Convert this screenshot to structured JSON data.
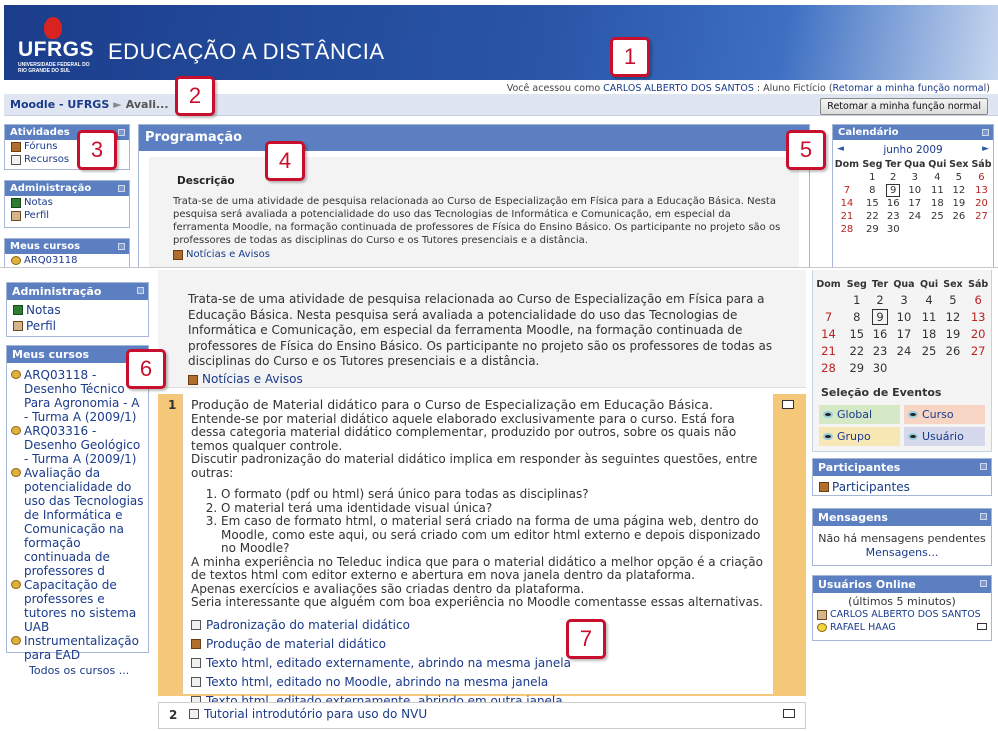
{
  "header": {
    "logo_text": "UFRGS",
    "logo_subtitle": "UNIVERSIDADE FEDERAL DO RIO GRANDE DO SUL",
    "site_title": "EDUCAÇÃO A DISTÂNCIA",
    "login_prefix": "Você acessou como",
    "login_user": "CARLOS ALBERTO DOS SANTOS",
    "login_role": ": Aluno Fictício (",
    "login_return_link": "Retomar a minha função normal",
    "login_suffix": ")"
  },
  "navbar": {
    "crumb_home": "Moodle - UFRGS",
    "crumb_sep": "►",
    "crumb_current": "Avali...",
    "return_button": "Retomar a minha função normal"
  },
  "blocks_top": {
    "atividades": {
      "title": "Atividades",
      "items": [
        "Fóruns",
        "Recursos"
      ]
    },
    "administracao": {
      "title": "Administração",
      "items": [
        "Notas",
        "Perfil"
      ]
    },
    "meus_cursos": {
      "title": "Meus cursos",
      "peek": "ARQ03118"
    }
  },
  "programacao": {
    "title": "Programação",
    "desc_heading": "Descrição",
    "desc_text": "Trata-se de uma atividade de pesquisa relacionada ao Curso de Especialização em Física para a Educação Básica. Nesta pesquisa será avaliada a potencialidade do uso das Tecnologias de Informática e Comunicação, em especial da ferramenta Moodle, na formação continuada de professores de Física do Ensino Básico. Os participante no projeto são os professores de todas as disciplinas do Curso e os Tutores presenciais e a distância.",
    "news_link": "Notícias e Avisos"
  },
  "calendar": {
    "title": "Calendário",
    "month": "junho 2009",
    "prev": "◄",
    "next": "►",
    "weekdays": [
      "Dom",
      "Seg",
      "Ter",
      "Qua",
      "Qui",
      "Sex",
      "Sáb"
    ],
    "weeks": [
      [
        "",
        "1",
        "2",
        "3",
        "4",
        "5",
        "6"
      ],
      [
        "7",
        "8",
        "9",
        "10",
        "11",
        "12",
        "13"
      ],
      [
        "14",
        "15",
        "16",
        "17",
        "18",
        "19",
        "20"
      ],
      [
        "21",
        "22",
        "23",
        "24",
        "25",
        "26",
        "27"
      ],
      [
        "28",
        "29",
        "30",
        "",
        "",
        "",
        ""
      ]
    ],
    "today": "9",
    "events_title": "Seleção de Eventos",
    "events": [
      "Global",
      "Curso",
      "Grupo",
      "Usuário"
    ]
  },
  "meus_cursos": {
    "title": "Meus cursos",
    "courses": [
      "ARQ03118 - Desenho Técnico Para Agronomia - A - Turma A (2009/1)",
      "ARQ03316 - Desenho Geológico - Turma A (2009/1)",
      "Avaliação da potencialidade do uso das Tecnologias de Informática e Comunicação na formação continuada de professores d",
      "Capacitação de professores e tutores no sistema UAB",
      "Instrumentalização para EAD"
    ],
    "all_courses": "Todos os cursos ..."
  },
  "topic1": {
    "number": "1",
    "title": "Produção de Material didático para o Curso de Especialização em Educação Básica.",
    "para1": "Entende-se por material didático aquele elaborado exclusivamente para o curso. Está fora dessa categoria material didático complementar, produzido por outros, sobre os quais não temos qualquer controle.",
    "para2": "Discutir padronização do material didático implica em responder às seguintes questões, entre outras:",
    "questions": [
      "O formato (pdf ou html) será único para todas as disciplinas?",
      "O material terá uma identidade visual única?",
      "Em caso de formato html, o material será criado na forma de uma página web, dentro do Moodle, como este aqui, ou será criado com um editor html externo e depois disponizado no Moodle?"
    ],
    "para3": "A minha experiência no Teleduc indica que para o material didático a melhor opção é a criação de textos html com editor externo e abertura em nova janela dentro da plataforma.",
    "para4": "Apenas exercícios e avaliações são criadas dentro da plataforma.",
    "para5": "Seria interessante que alguém com boa experiência no Moodle comentasse essas alternativas.",
    "resources": [
      {
        "label": "Padronização do material didático",
        "icon": "resource-icon"
      },
      {
        "label": "Produção de material didático",
        "icon": "forum-icon"
      },
      {
        "label": "Texto html, editado externamente, abrindo na mesma janela",
        "icon": "resource-icon"
      },
      {
        "label": "Texto html, editado no Moodle, abrindo na mesma janela",
        "icon": "resource-icon"
      },
      {
        "label": "Texto html, editado externamente, abrindo em outra janela",
        "icon": "resource-icon"
      }
    ]
  },
  "topic2": {
    "number": "2",
    "resource": "Tutorial introdutório para uso do NVU"
  },
  "participantes": {
    "title": "Participantes",
    "link": "Participantes"
  },
  "mensagens": {
    "title": "Mensagens",
    "text": "Não há mensagens pendentes",
    "link": "Mensagens..."
  },
  "usuarios_online": {
    "title": "Usuários Online",
    "subtitle": "(últimos 5 minutos)",
    "users": [
      "CARLOS ALBERTO DOS SANTOS",
      "RAFAEL HAAG"
    ]
  },
  "callouts": [
    "1",
    "2",
    "3",
    "4",
    "5",
    "6",
    "7"
  ],
  "colors": {
    "accent": "#5b7fc0",
    "banner": "#1b3d8b",
    "callout": "#c8102e",
    "highlight": "#f5c879"
  }
}
